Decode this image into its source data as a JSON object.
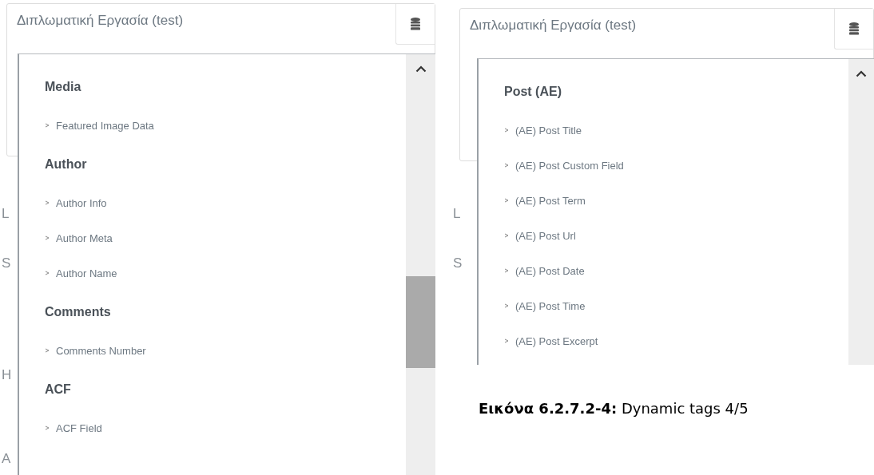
{
  "panels": [
    {
      "field_value": "Διπλωματική Εργασία (test)",
      "side_labels": [
        "L",
        "S",
        "H",
        "A"
      ],
      "thumb_shown": true,
      "entries": [
        {
          "kind": "heading",
          "text": "Media"
        },
        {
          "kind": "item",
          "text": "Featured Image Data"
        },
        {
          "kind": "heading",
          "text": "Author"
        },
        {
          "kind": "item",
          "text": "Author Info"
        },
        {
          "kind": "item",
          "text": "Author Meta"
        },
        {
          "kind": "item",
          "text": "Author Name"
        },
        {
          "kind": "heading",
          "text": "Comments"
        },
        {
          "kind": "item",
          "text": "Comments Number"
        },
        {
          "kind": "heading",
          "text": "ACF"
        },
        {
          "kind": "item",
          "text": "ACF Field"
        }
      ]
    },
    {
      "field_value": "Διπλωματική Εργασία (test)",
      "side_labels": [
        "L",
        "S"
      ],
      "thumb_shown": false,
      "entries": [
        {
          "kind": "heading",
          "text": "Post (AE)"
        },
        {
          "kind": "item",
          "text": "(AE) Post Title"
        },
        {
          "kind": "item",
          "text": "(AE) Post Custom Field"
        },
        {
          "kind": "item",
          "text": "(AE) Post Term"
        },
        {
          "kind": "item",
          "text": "(AE) Post Url"
        },
        {
          "kind": "item",
          "text": "(AE) Post Date"
        },
        {
          "kind": "item",
          "text": "(AE) Post Time"
        },
        {
          "kind": "item",
          "text": "(AE) Post Excerpt"
        }
      ]
    }
  ],
  "caption": "**Εικόνα 6.2.7.2-4:** Dynamic tags 4/5"
}
